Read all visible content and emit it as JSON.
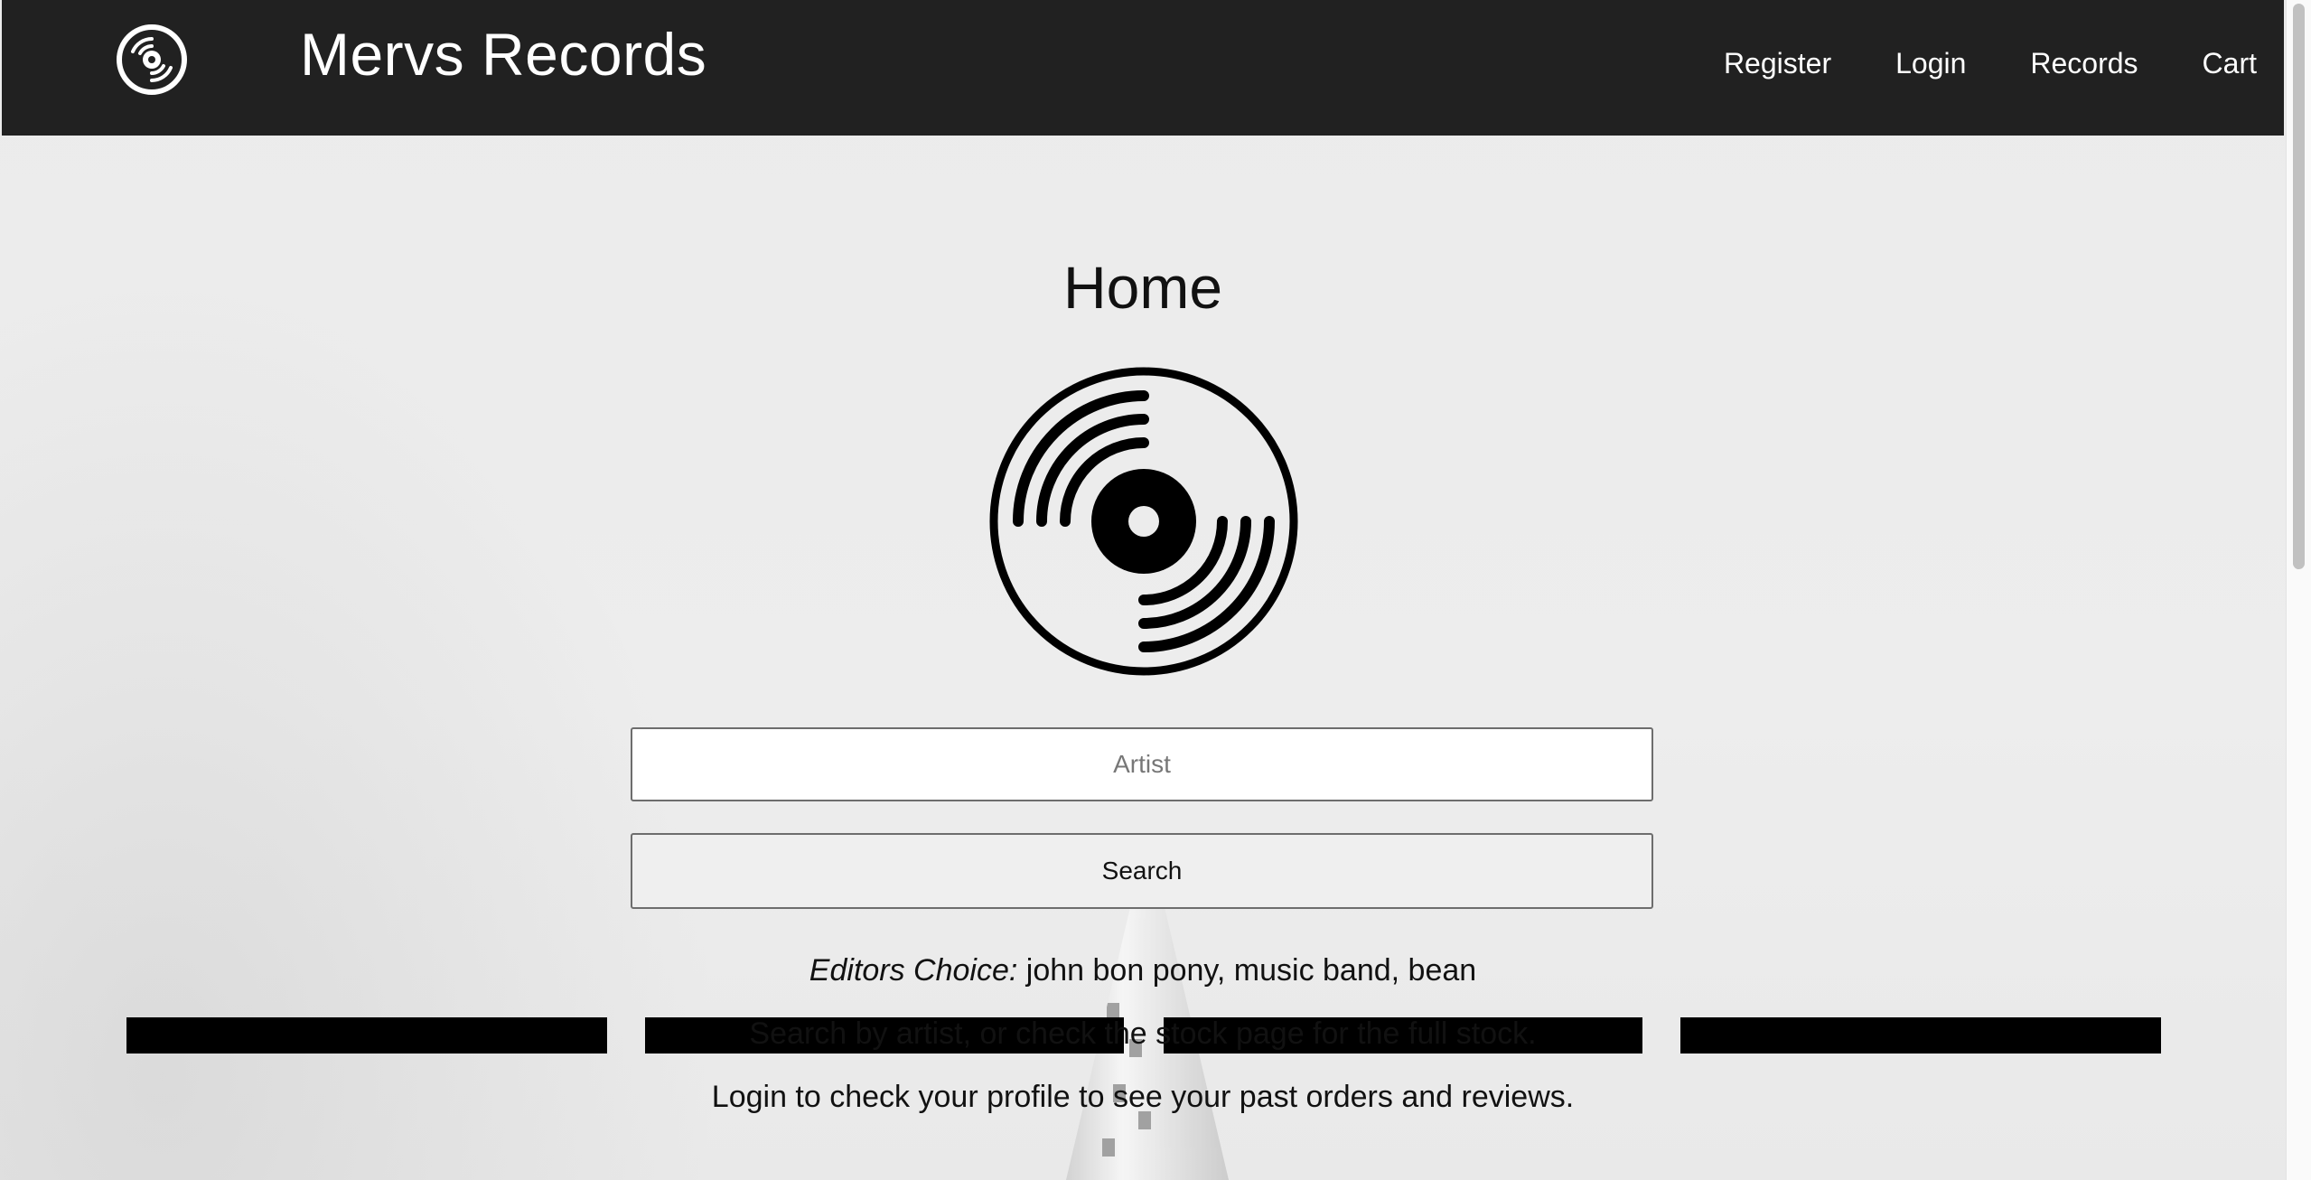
{
  "header": {
    "brand": "Mervs Records",
    "nav": [
      "Register",
      "Login",
      "Records",
      "Cart"
    ]
  },
  "main": {
    "title": "Home",
    "search": {
      "placeholder": "Artist",
      "button_label": "Search"
    },
    "editors_choice_label": "Editors Choice:",
    "editors_choice_value": " john bon pony, music band, bean",
    "hint_search": "Search by artist, or check the stock page for the full stock.",
    "hint_login": "Login to check your profile to see your past orders and reviews."
  },
  "colors": {
    "navbar": "#212121",
    "background": "#ececec",
    "card": "#000000"
  },
  "icons": [
    "vinyl-record-logo-icon",
    "vinyl-record-icon"
  ]
}
